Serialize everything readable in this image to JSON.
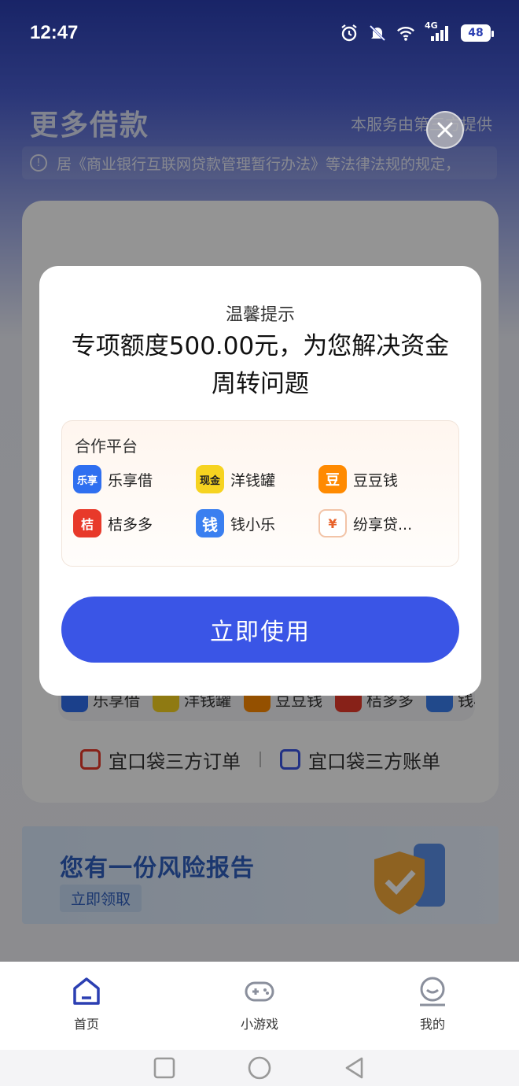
{
  "status_bar": {
    "time": "12:47",
    "network": "4G",
    "battery": "48"
  },
  "header": {
    "title": "更多借款",
    "provider": "本服务由第三方提供",
    "notice": "居《商业银行互联网贷款管理暂行办法》等法律法规的规定，"
  },
  "card": {
    "mini_platforms": [
      "乐享借",
      "洋钱罐",
      "豆豆钱",
      "桔多多",
      "钱小乐"
    ],
    "links": {
      "orders": "宜口袋三方订单",
      "bills": "宜口袋三方账单"
    }
  },
  "banner": {
    "title": "您有一份风险报告",
    "button": "立即领取"
  },
  "modal": {
    "subtitle": "温馨提示",
    "title": "专项额度500.00元，为您解决资金周转问题",
    "partner_label": "合作平台",
    "partners": [
      {
        "name": "乐享借",
        "logo_text": "乐享",
        "color": "#2f6ff0"
      },
      {
        "name": "洋钱罐",
        "logo_text": "现金",
        "color": "#f6d320"
      },
      {
        "name": "豆豆钱",
        "logo_text": "豆",
        "color": "#ff8a00"
      },
      {
        "name": "桔多多",
        "logo_text": "桔",
        "color": "#e8392a"
      },
      {
        "name": "钱小乐",
        "logo_text": "钱",
        "color": "#3a7ff0"
      },
      {
        "name": "纷享贷...",
        "logo_text": "¥",
        "color": "#ffffff"
      }
    ],
    "button": "立即使用"
  },
  "tabbar": {
    "home": "首页",
    "games": "小游戏",
    "mine": "我的"
  },
  "colors": {
    "accent": "#3a55e6",
    "header_bg": "#2b3fb2"
  }
}
